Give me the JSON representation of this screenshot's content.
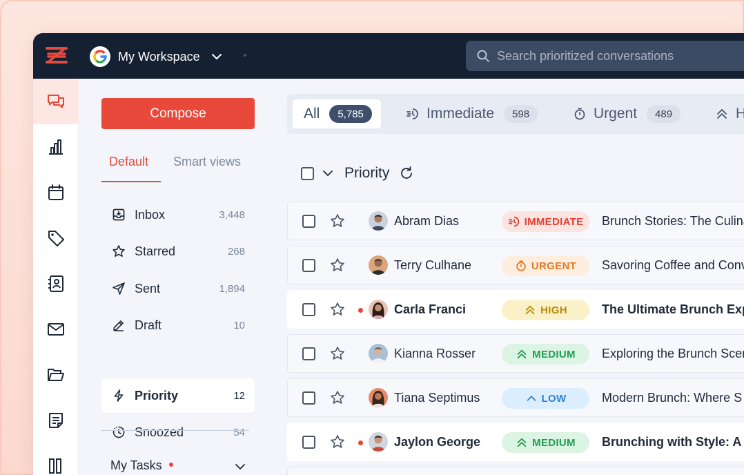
{
  "colors": {
    "accent": "#e9493a",
    "topbar": "#152133",
    "immediate": "#e33f32",
    "urgent": "#e17a22",
    "high": "#b88a06",
    "medium": "#1f9d4f",
    "low": "#2a82d6"
  },
  "topbar": {
    "workspace_label": "My Workspace",
    "search_placeholder": "Search prioritized conversations"
  },
  "rail": {
    "items": [
      "chat-icon",
      "bar-chart-icon",
      "calendar-icon",
      "tag-icon",
      "contacts-icon",
      "mail-icon",
      "folder-icon",
      "notes-icon",
      "columns-icon"
    ]
  },
  "panel": {
    "compose_label": "Compose",
    "tabs": {
      "default": "Default",
      "smart": "Smart views"
    },
    "folders": [
      {
        "label": "Inbox",
        "count": "3,448",
        "icon": "inbox-icon"
      },
      {
        "label": "Starred",
        "count": "268",
        "icon": "star-icon"
      },
      {
        "label": "Sent",
        "count": "1,894",
        "icon": "send-icon"
      },
      {
        "label": "Draft",
        "count": "10",
        "icon": "pencil-icon"
      },
      {
        "label": "Priority",
        "count": "12",
        "icon": "lightning-icon"
      },
      {
        "label": "Snoozed",
        "count": "54",
        "icon": "snooze-icon"
      }
    ],
    "my_tasks_label": "My Tasks"
  },
  "filters": [
    {
      "label": "All",
      "count": "5,785"
    },
    {
      "label": "Immediate",
      "count": "598"
    },
    {
      "label": "Urgent",
      "count": "489"
    },
    {
      "label": "H"
    }
  ],
  "list": {
    "heading": "Priority",
    "rows": [
      {
        "sender": "Abram Dias",
        "priority": "IMMEDIATE",
        "subject": "Brunch Stories: The Culina",
        "unread": false
      },
      {
        "sender": "Terry Culhane",
        "priority": "URGENT",
        "subject": "Savoring Coffee and Conv",
        "unread": false
      },
      {
        "sender": "Carla Franci",
        "priority": "HIGH",
        "subject": "The Ultimate Brunch Expe",
        "unread": true
      },
      {
        "sender": "Kianna Rosser",
        "priority": "MEDIUM",
        "subject": "Exploring the Brunch Scen",
        "unread": false
      },
      {
        "sender": "Tiana Septimus",
        "priority": "LOW",
        "subject": "Modern Brunch: Where S",
        "unread": false
      },
      {
        "sender": "Jaylon George",
        "priority": "MEDIUM",
        "subject": "Brunching with Style: A C",
        "unread": true
      }
    ]
  }
}
